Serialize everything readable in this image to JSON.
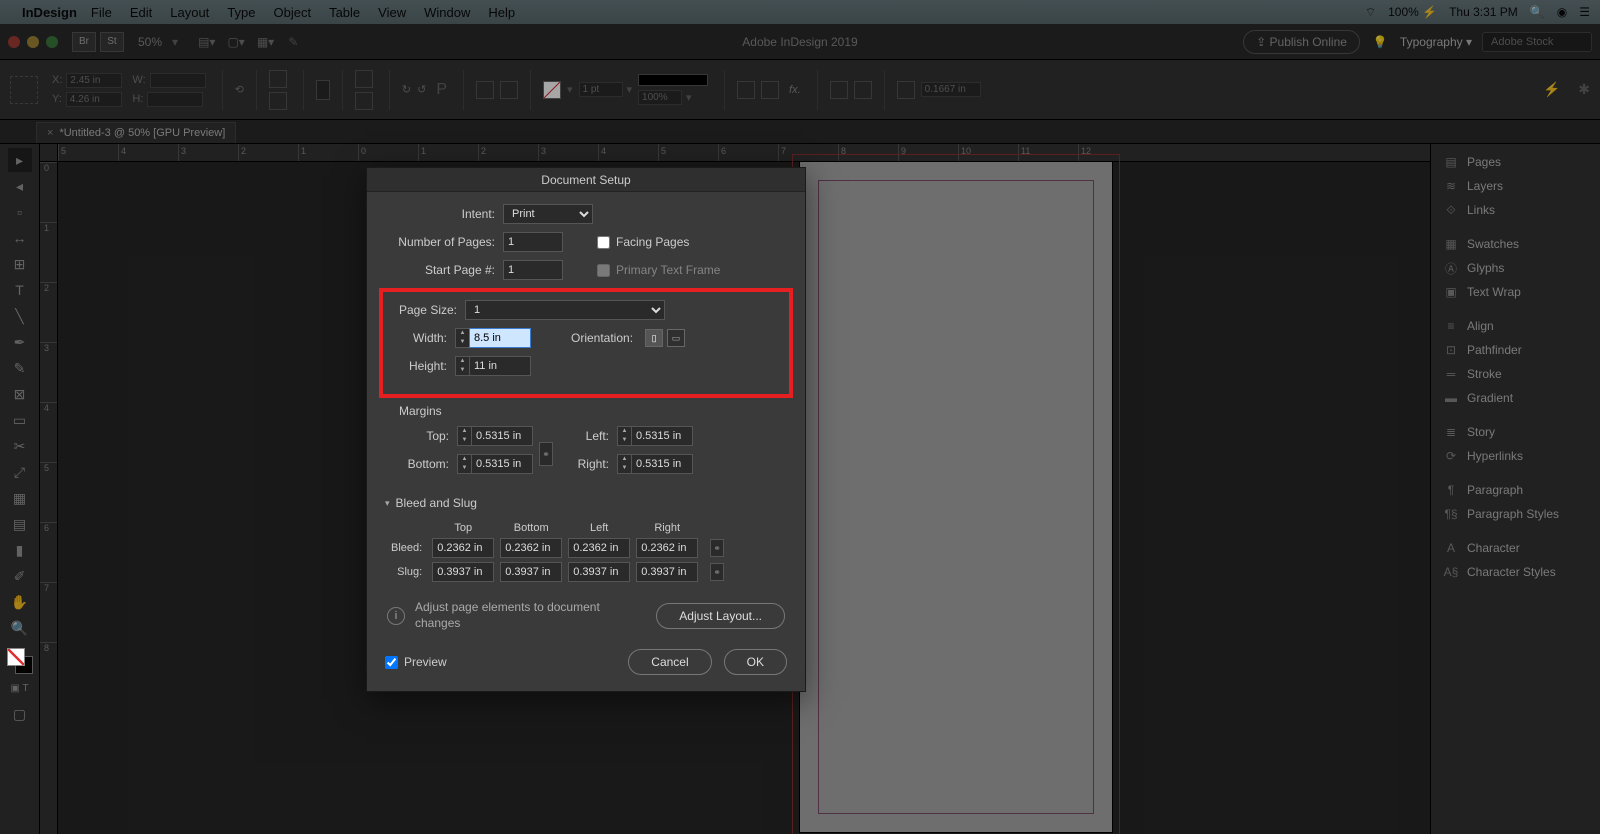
{
  "mac_menu": {
    "app": "InDesign",
    "items": [
      "File",
      "Edit",
      "Layout",
      "Type",
      "Object",
      "Table",
      "View",
      "Window",
      "Help"
    ],
    "battery": "100%",
    "clock": "Thu 3:31 PM"
  },
  "app_bar": {
    "br": "Br",
    "st": "St",
    "zoom": "50%",
    "title": "Adobe InDesign 2019",
    "publish": "Publish Online",
    "workspace": "Typography",
    "search_placeholder": "Adobe Stock"
  },
  "ctrl": {
    "x": "2.45 in",
    "y": "4.26 in",
    "w": "",
    "h": "",
    "stroke_pt": "1 pt",
    "scale": "100%",
    "leading": "0.1667 in"
  },
  "tab": {
    "close": "×",
    "label": "*Untitled-3 @ 50% [GPU Preview]"
  },
  "ruler_h": [
    "5",
    "4",
    "3",
    "2",
    "1",
    "0",
    "1",
    "2",
    "3",
    "4",
    "5",
    "6",
    "7",
    "8",
    "9",
    "10",
    "11",
    "12"
  ],
  "ruler_v": [
    "0",
    "1",
    "2",
    "3",
    "4",
    "5",
    "6",
    "7",
    "8"
  ],
  "panels": [
    "Pages",
    "Layers",
    "Links",
    "",
    "Swatches",
    "Glyphs",
    "Text Wrap",
    "",
    "Align",
    "Pathfinder",
    "Stroke",
    "Gradient",
    "",
    "Story",
    "Hyperlinks",
    "",
    "Paragraph",
    "Paragraph Styles",
    "",
    "Character",
    "Character Styles"
  ],
  "dialog": {
    "title": "Document Setup",
    "intent_label": "Intent:",
    "intent_value": "Print",
    "num_pages_label": "Number of Pages:",
    "num_pages": "1",
    "start_page_label": "Start Page #:",
    "start_page": "1",
    "facing_label": "Facing Pages",
    "primary_label": "Primary Text Frame",
    "page_size_label": "Page Size:",
    "page_size_value": "1",
    "width_label": "Width:",
    "width": "8.5 in",
    "height_label": "Height:",
    "height": "11 in",
    "orientation_label": "Orientation:",
    "margins_title": "Margins",
    "top_label": "Top:",
    "bottom_label": "Bottom:",
    "left_label": "Left:",
    "right_label": "Right:",
    "margin_top": "0.5315 in",
    "margin_bottom": "0.5315 in",
    "margin_left": "0.5315 in",
    "margin_right": "0.5315 in",
    "bleed_title": "Bleed and Slug",
    "col_top": "Top",
    "col_bottom": "Bottom",
    "col_left": "Left",
    "col_right": "Right",
    "bleed_label": "Bleed:",
    "slug_label": "Slug:",
    "bleed_top": "0.2362 in",
    "bleed_bottom": "0.2362 in",
    "bleed_left": "0.2362 in",
    "bleed_right": "0.2362 in",
    "slug_top": "0.3937 in",
    "slug_bottom": "0.3937 in",
    "slug_left": "0.3937 in",
    "slug_right": "0.3937 in",
    "adjust_text": "Adjust page elements to document changes",
    "adjust_btn": "Adjust Layout...",
    "preview_label": "Preview",
    "cancel": "Cancel",
    "ok": "OK"
  }
}
